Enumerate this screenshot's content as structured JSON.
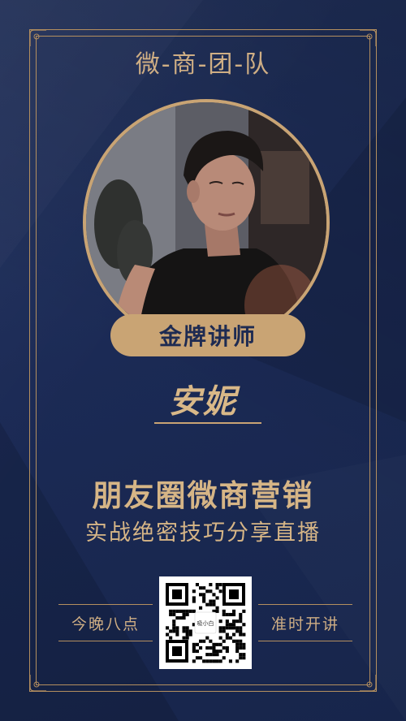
{
  "header": {
    "title": "微-商-团-队"
  },
  "speaker": {
    "badge": "金牌讲师",
    "name": "安妮"
  },
  "event": {
    "headline": "朋友圈微商营销",
    "subline": "实战绝密技巧分享直播"
  },
  "schedule": {
    "left": "今晚八点",
    "right": "准时开讲"
  },
  "qr": {
    "center_label": "吸小白"
  },
  "colors": {
    "background": "#1c2c57",
    "gold": "#c9a474",
    "gold_text": "#d6b586"
  }
}
